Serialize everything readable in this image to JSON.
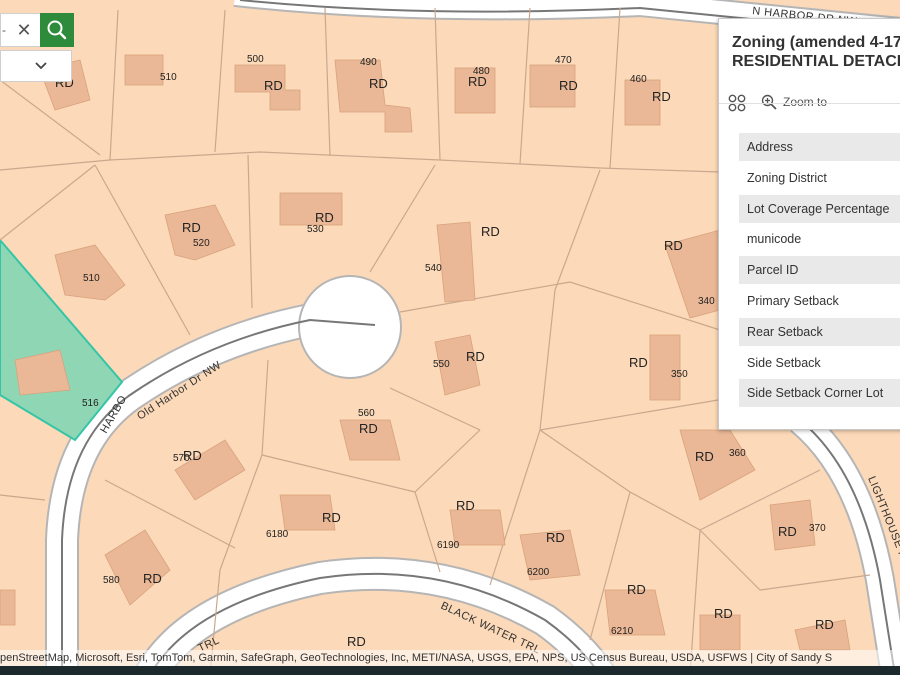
{
  "search": {
    "placeholder_fragment": "-",
    "clear_icon": "close-icon",
    "button_icon": "search-icon",
    "dropdown_icon": "chevron-down-icon"
  },
  "streets": {
    "north": "N HARBOR DR NW",
    "old_harbor": "Old Harbor Dr NW",
    "harbor_short": "HARBO",
    "black_water": "BLACK WATER TRL",
    "trl_fragment": "TRL",
    "lighthouse": "LIGHTHOUSE PT"
  },
  "parcels": [
    {
      "zone": "RD",
      "number": "510"
    },
    {
      "zone": "RD",
      "number": "500"
    },
    {
      "zone": "RD",
      "number": "490"
    },
    {
      "zone": "RD",
      "number": "480"
    },
    {
      "zone": "RD",
      "number": "470"
    },
    {
      "zone": "RD",
      "number": "460"
    },
    {
      "zone": "RD",
      "number": "520"
    },
    {
      "zone": "RD",
      "number": "530"
    },
    {
      "zone": "RD",
      "number": "540"
    },
    {
      "zone": "RD",
      "number": "340"
    },
    {
      "zone": "RD",
      "number": "550"
    },
    {
      "zone": "RD",
      "number": "350"
    },
    {
      "zone": "RD",
      "number": "560"
    },
    {
      "zone": "RD",
      "number": "570"
    },
    {
      "zone": "RD",
      "number": "360"
    },
    {
      "zone": "RD",
      "number": "6180"
    },
    {
      "zone": "RD",
      "number": "6190"
    },
    {
      "zone": "RD",
      "number": "6200"
    },
    {
      "zone": "RD",
      "number": "370"
    },
    {
      "zone": "RD",
      "number": "580"
    },
    {
      "zone": "RD",
      "number": "6210"
    },
    {
      "zone": "RD",
      "number": ""
    },
    {
      "zone": "RD",
      "number": ""
    },
    {
      "zone": "RD",
      "number": ""
    },
    {
      "zone": "",
      "number": "510"
    },
    {
      "zone": "",
      "number": "516"
    }
  ],
  "popup": {
    "title_line1": "Zoning (amended 4-17",
    "title_line2": "RESIDENTIAL DETACH",
    "zoom_label": "Zoom to",
    "fields": [
      "Address",
      "Zoning District",
      "Lot Coverage Percentage",
      "municode",
      "Parcel ID",
      "Primary Setback",
      "Rear Setback",
      "Side Setback",
      "Side Setback Corner Lot"
    ]
  },
  "attribution": "penStreetMap, Microsoft, Esri, TomTom, Garmin, SafeGraph, GeoTechnologies, Inc, METI/NASA, USGS, EPA, NPS, US Census Bureau, USDA, USFWS | City of Sandy S",
  "colors": {
    "parcel_fill": "#fcd9b8",
    "parcel_line": "#c9a88e",
    "building": "#eab896",
    "selected_fill": "#8fd6b4",
    "selected_line": "#34c5a7",
    "road": "#ffffff",
    "accent_green": "#2e8b3c"
  }
}
